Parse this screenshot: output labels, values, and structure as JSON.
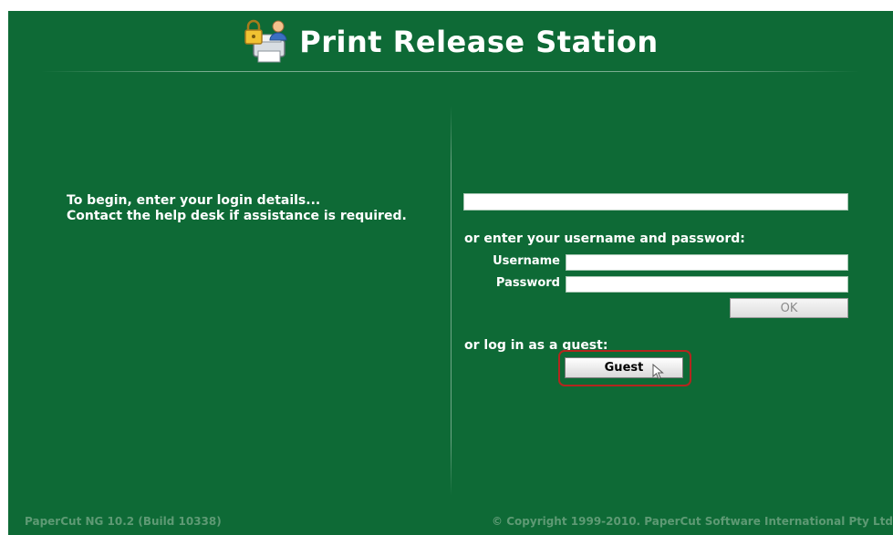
{
  "header": {
    "title": "Print Release Station",
    "logo_icon": "printer-lock-user-icon"
  },
  "instructions": {
    "line1": "To begin, enter your login details...",
    "line2": "Contact the help desk if assistance is required."
  },
  "login": {
    "id_value": "",
    "userpass_prompt": "or enter your username and password:",
    "username_label": "Username",
    "username_value": "",
    "password_label": "Password",
    "password_value": "",
    "ok_label": "OK",
    "guest_prompt": "or log in as a guest:",
    "guest_label": "Guest"
  },
  "footer": {
    "version": "PaperCut NG 10.2 (Build 10338)",
    "copyright": "© Copyright 1999-2010. PaperCut Software International Pty Ltd"
  },
  "colors": {
    "background": "#0e6a36",
    "highlight": "#b3261e"
  }
}
